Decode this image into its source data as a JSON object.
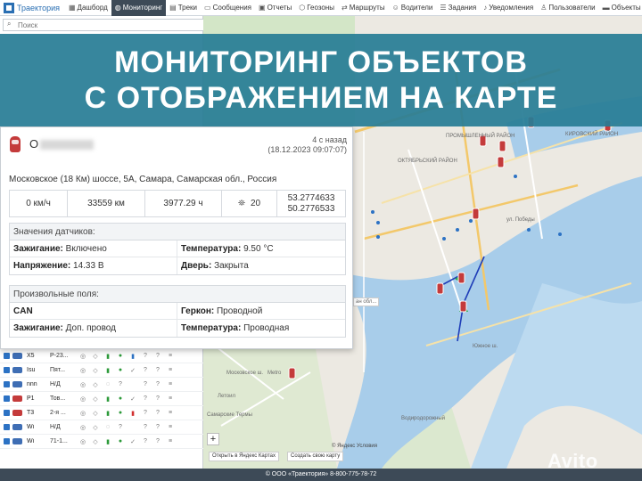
{
  "nav": {
    "logo": "Траектория",
    "items": [
      {
        "label": "Дашборд",
        "icon": "dashboard-icon",
        "active": false
      },
      {
        "label": "Мониторинг",
        "icon": "globe-icon",
        "active": true
      },
      {
        "label": "Треки",
        "icon": "track-icon",
        "active": false
      },
      {
        "label": "Сообщения",
        "icon": "messages-icon",
        "active": false
      },
      {
        "label": "Отчеты",
        "icon": "reports-icon",
        "active": false
      },
      {
        "label": "Геозоны",
        "icon": "geozone-icon",
        "active": false
      },
      {
        "label": "Маршруты",
        "icon": "routes-icon",
        "active": false
      },
      {
        "label": "Водители",
        "icon": "drivers-icon",
        "active": false
      },
      {
        "label": "Задания",
        "icon": "tasks-icon",
        "active": false
      },
      {
        "label": "Уведомления",
        "icon": "bell-icon",
        "active": false
      },
      {
        "label": "Пользователи",
        "icon": "users-icon",
        "active": false
      },
      {
        "label": "Объекты",
        "icon": "objects-icon",
        "active": false
      }
    ]
  },
  "search": {
    "placeholder": "Поиск"
  },
  "banner": {
    "line1": "МОНИТОРИНГ ОБЪЕКТОВ",
    "line2": "С ОТОБРАЖЕНИЕМ НА КАРТЕ"
  },
  "card": {
    "name_prefix": "О",
    "time_ago": "4 с назад",
    "timestamp": "(18.12.2023 09:07:07)",
    "address": "Московское (18 Км) шоссе, 5А, Самара, Самарская обл., Россия",
    "speed": "0 км/ч",
    "mileage": "33559 км",
    "engine_hours": "3977.29 ч",
    "satellites": "20",
    "lat": "53.2774633",
    "lon": "50.2776533",
    "sensors_title": "Значения датчиков:",
    "sensors": [
      {
        "label": "Зажигание:",
        "value": " Включено"
      },
      {
        "label": "Температура:",
        "value": " 9.50 °С"
      },
      {
        "label": "Напряжение:",
        "value": " 14.33 В"
      },
      {
        "label": "Дверь:",
        "value": " Закрыта"
      }
    ],
    "custom_title": "Произвольные поля:",
    "custom": [
      {
        "label": "CAN",
        "value": ""
      },
      {
        "label": "Геркон:",
        "value": " Проводной"
      },
      {
        "label": "Зажигание:",
        "value": " Доп. провод"
      },
      {
        "label": "Температура:",
        "value": " Проводная"
      }
    ]
  },
  "objects": [
    {
      "name": "Х5",
      "addr": "Р-23...",
      "car_color": "blue",
      "status": "green"
    },
    {
      "name": "Isu",
      "addr": "Пят...",
      "car_color": "blue",
      "status": "green"
    },
    {
      "name": "nnn",
      "addr": "Н/Д",
      "car_color": "blue",
      "status": "none"
    },
    {
      "name": "Р1",
      "addr": "Тов...",
      "car_color": "red",
      "status": "green"
    },
    {
      "name": "Т3",
      "addr": "2-я ...",
      "car_color": "red",
      "status": "green"
    },
    {
      "name": "Wi",
      "addr": "Н/Д",
      "car_color": "blue",
      "status": "none"
    },
    {
      "name": "Wi",
      "addr": "71-1...",
      "car_color": "blue",
      "status": "green"
    }
  ],
  "map": {
    "labels": [
      "ПРОМЫШЛЕННЫЙ РАЙОН",
      "КИРОВСКИЙ РАЙОН",
      "ОКТЯБРЬСКИЙ РАЙОН",
      "ул. Победы",
      "Московское ш.",
      "Южное ш.",
      "Самарские Термы",
      "Летоил",
      "Metro",
      "Водиродорожный"
    ],
    "copyright": "© Яндекс Условия",
    "open_in": "Открыть в Яндекс Картах",
    "create_map": "Создать свою карту",
    "popup_fragment": "ан обл..."
  },
  "footer": "© ООО «Траектория» 8-800-775-78-72",
  "watermark": "Avito"
}
